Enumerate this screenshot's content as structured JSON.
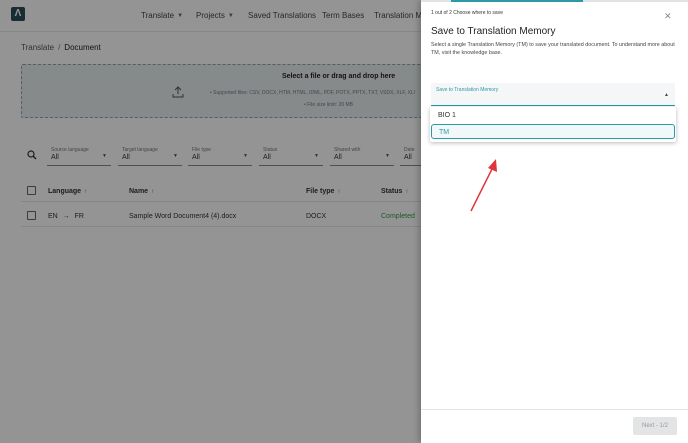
{
  "nav": {
    "items": [
      {
        "label": "Translate",
        "chevron": true
      },
      {
        "label": "Projects",
        "chevron": true
      },
      {
        "label": "Saved Translations",
        "chevron": false
      },
      {
        "label": "Term Bases",
        "chevron": false
      },
      {
        "label": "Translation Me",
        "chevron": false
      }
    ]
  },
  "breadcrumb": {
    "root": "Translate",
    "separator": "/",
    "current": "Document"
  },
  "upload": {
    "title": "Select a file or drag and drop here",
    "supported": "Supported files: CSV, DOCX, HTM, HTML, IDML, PDF, POTX, PPTX, TXT, VSDX, XLF, XLI",
    "limit": "File size limit: 20 MB"
  },
  "filters": [
    {
      "label": "Source language",
      "value": "All"
    },
    {
      "label": "Target language",
      "value": "All"
    },
    {
      "label": "File type",
      "value": "All"
    },
    {
      "label": "Status",
      "value": "All"
    },
    {
      "label": "Shared with",
      "value": "All"
    },
    {
      "label": "Date",
      "value": "All"
    }
  ],
  "table": {
    "headers": {
      "language": "Language",
      "name": "Name",
      "file_type": "File type",
      "status": "Status"
    },
    "rows": [
      {
        "source": "EN",
        "arrow": "→",
        "target": "FR",
        "name": "Sample Word Document4 (4).docx",
        "file_type": "DOCX",
        "status": "Completed"
      }
    ]
  },
  "panel": {
    "step": "1 out of 2 Choose where to save",
    "close_icon": "close-icon",
    "title": "Save to Translation Memory",
    "description": "Select a single Translation Memory (TM) to save your translated document. To understand more about TM, visit the knowledge base.",
    "select_label": "Save to Translation Memory",
    "options": [
      {
        "label": "BIO 1",
        "selected": false
      },
      {
        "label": "TM",
        "selected": true
      }
    ],
    "next_label": "Next - 1/2",
    "progress_fraction": 0.5
  },
  "colors": {
    "accent": "#2c9aa6",
    "brand": "#2a4d5a",
    "annotation_arrow": "#e0353b",
    "completed": "#3a9a46"
  }
}
